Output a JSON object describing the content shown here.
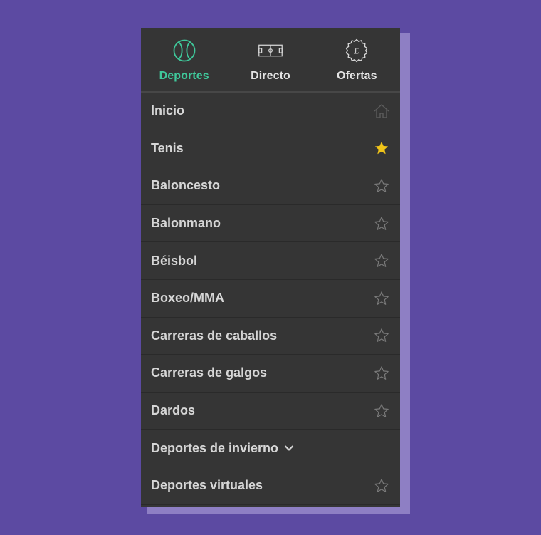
{
  "nav": {
    "tabs": [
      {
        "label": "Deportes",
        "icon": "tennis-ball-icon",
        "active": true
      },
      {
        "label": "Directo",
        "icon": "pitch-icon",
        "active": false
      },
      {
        "label": "Ofertas",
        "icon": "pound-badge-icon",
        "active": false
      }
    ]
  },
  "menu": {
    "items": [
      {
        "label": "Inicio",
        "icon": "home-icon"
      },
      {
        "label": "Tenis",
        "icon": "star-filled-icon"
      },
      {
        "label": "Baloncesto",
        "icon": "star-outline-icon"
      },
      {
        "label": "Balonmano",
        "icon": "star-outline-icon"
      },
      {
        "label": "Béisbol",
        "icon": "star-outline-icon"
      },
      {
        "label": "Boxeo/MMA",
        "icon": "star-outline-icon"
      },
      {
        "label": "Carreras de caballos",
        "icon": "star-outline-icon"
      },
      {
        "label": "Carreras de galgos",
        "icon": "star-outline-icon"
      },
      {
        "label": "Dardos",
        "icon": "star-outline-icon"
      },
      {
        "label": "Deportes de invierno",
        "icon": "chevron-down-icon"
      },
      {
        "label": "Deportes virtuales",
        "icon": "star-outline-icon"
      }
    ]
  },
  "colors": {
    "background": "#5c4aa2",
    "panel": "#353535",
    "accent": "#3fc79a",
    "favorite": "#f0c419"
  }
}
